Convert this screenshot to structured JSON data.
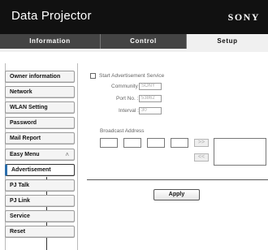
{
  "app": {
    "title": "Data Projector",
    "brand": "SONY"
  },
  "tabs": [
    {
      "label": "Information"
    },
    {
      "label": "Control"
    },
    {
      "label": "Setup"
    }
  ],
  "sidebar": {
    "items": [
      {
        "label": "Owner information"
      },
      {
        "label": "Network"
      },
      {
        "label": "WLAN Setting"
      },
      {
        "label": "Password"
      },
      {
        "label": "Mail Report"
      },
      {
        "label": "Easy Menu",
        "icon": "chevron-up-icon"
      },
      {
        "label": "Advertisement",
        "selected": true
      },
      {
        "label": "PJ Talk"
      },
      {
        "label": "PJ Link"
      },
      {
        "label": "Service"
      },
      {
        "label": "Reset"
      }
    ]
  },
  "advertisement": {
    "start_service": {
      "label": "Start Advertisement Service",
      "checked": false
    },
    "community": {
      "label": "Community :",
      "value": "SONY"
    },
    "port": {
      "label": "Port No. :",
      "value": "53862"
    },
    "interval": {
      "label": "Interval :",
      "value": "30"
    },
    "broadcast": {
      "label": "Broadcast Address",
      "octets": [
        "",
        "",
        "",
        ""
      ],
      "add_label": ">>",
      "remove_label": "<<",
      "addresses": []
    },
    "apply_label": "Apply"
  },
  "colors": {
    "header_bg": "#111111",
    "tab_inactive": "#444444",
    "tab_active": "#f0f0f0",
    "selection_accent": "#2b6fae"
  }
}
